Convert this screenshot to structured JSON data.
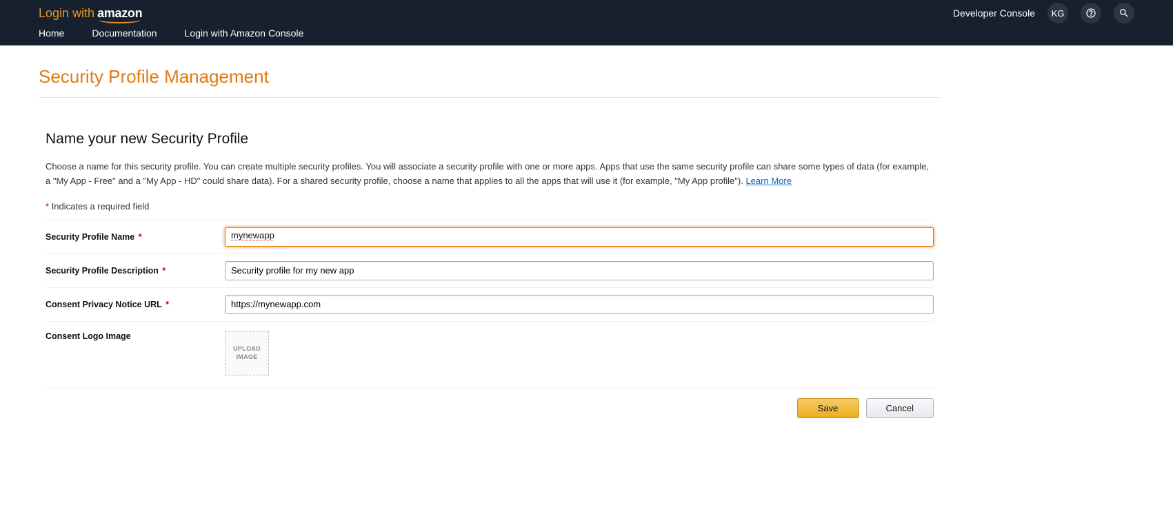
{
  "header": {
    "brand_prefix": "Login with",
    "brand_logo": "amazon",
    "developer_console": "Developer Console",
    "avatar_initials": "KG"
  },
  "nav": {
    "home": "Home",
    "documentation": "Documentation",
    "lwa_console": "Login with Amazon Console"
  },
  "page": {
    "title": "Security Profile Management",
    "section_title": "Name your new Security Profile",
    "intro_text": "Choose a name for this security profile. You can create multiple security profiles. You will associate a security profile with one or more apps. Apps that use the same security profile can share some types of data (for example, a \"My App - Free\" and a \"My App - HD\" could share data). For a shared security profile, choose a name that applies to all the apps that will use it (for example, \"My App profile\"). ",
    "learn_more": "Learn More",
    "required_note": "Indicates a required field"
  },
  "form": {
    "name_label": "Security Profile Name",
    "name_value": "mynewapp",
    "desc_label": "Security Profile Description",
    "desc_value": "Security profile for my new app",
    "privacy_label": "Consent Privacy Notice URL",
    "privacy_value": "https://mynewapp.com",
    "logo_label": "Consent Logo Image",
    "upload_text": "UPLOAD IMAGE"
  },
  "actions": {
    "save": "Save",
    "cancel": "Cancel"
  }
}
